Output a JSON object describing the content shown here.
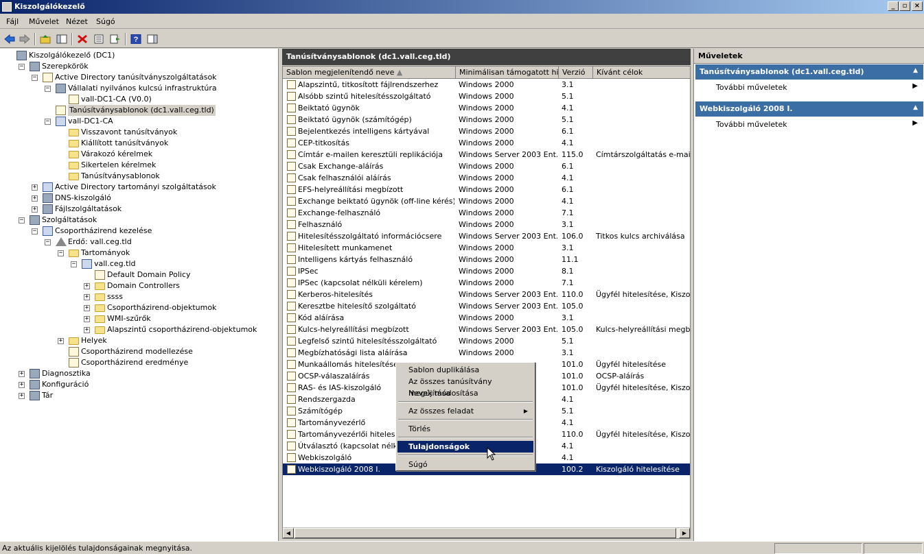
{
  "window": {
    "title": "Kiszolgálókezelő"
  },
  "menu": [
    "Fájl",
    "Művelet",
    "Nézet",
    "Súgó"
  ],
  "toolbar": {
    "buttons": [
      "back-icon",
      "forward-icon",
      "up-folder-icon",
      "show-hide-tree-icon",
      "delete-icon",
      "properties-icon",
      "export-icon",
      "help-icon",
      "show-hide-action-pane-icon"
    ]
  },
  "tree": [
    {
      "label": "Kiszolgálókezelő (DC1)",
      "depth": 0,
      "toggle": "",
      "icon": "server"
    },
    {
      "label": "Szerepkörök",
      "depth": 1,
      "toggle": "-",
      "icon": "server"
    },
    {
      "label": "Active Directory tanúsítványszolgáltatások",
      "depth": 2,
      "toggle": "-",
      "icon": "cert"
    },
    {
      "label": "Vállalati nyilvános kulcsú infrastruktúra",
      "depth": 3,
      "toggle": "-",
      "icon": "server"
    },
    {
      "label": "vall-DC1-CA (V0.0)",
      "depth": 4,
      "toggle": "",
      "icon": "cert"
    },
    {
      "label": "Tanúsítványsablonok (dc1.vall.ceg.tld)",
      "depth": 3,
      "toggle": "",
      "icon": "cert",
      "selected": true
    },
    {
      "label": "vall-DC1-CA",
      "depth": 3,
      "toggle": "-",
      "icon": "ad"
    },
    {
      "label": "Visszavont tanúsítványok",
      "depth": 4,
      "toggle": "",
      "icon": "folder"
    },
    {
      "label": "Kiállított tanúsítványok",
      "depth": 4,
      "toggle": "",
      "icon": "folder"
    },
    {
      "label": "Várakozó kérelmek",
      "depth": 4,
      "toggle": "",
      "icon": "folder"
    },
    {
      "label": "Sikertelen kérelmek",
      "depth": 4,
      "toggle": "",
      "icon": "folder"
    },
    {
      "label": "Tanúsítványsablonok",
      "depth": 4,
      "toggle": "",
      "icon": "folder"
    },
    {
      "label": "Active Directory tartományi szolgáltatások",
      "depth": 2,
      "toggle": "+",
      "icon": "ad"
    },
    {
      "label": "DNS-kiszolgáló",
      "depth": 2,
      "toggle": "+",
      "icon": "server"
    },
    {
      "label": "Fájlszolgáltatások",
      "depth": 2,
      "toggle": "+",
      "icon": "server"
    },
    {
      "label": "Szolgáltatások",
      "depth": 1,
      "toggle": "-",
      "icon": "server"
    },
    {
      "label": "Csoportházirend kezelése",
      "depth": 2,
      "toggle": "-",
      "icon": "ad"
    },
    {
      "label": "Erdő: vall.ceg.tld",
      "depth": 3,
      "toggle": "-",
      "icon": "tri"
    },
    {
      "label": "Tartományok",
      "depth": 4,
      "toggle": "-",
      "icon": "folder"
    },
    {
      "label": "vall.ceg.tld",
      "depth": 5,
      "toggle": "-",
      "icon": "ad"
    },
    {
      "label": "Default Domain Policy",
      "depth": 6,
      "toggle": "",
      "icon": "cert"
    },
    {
      "label": "Domain Controllers",
      "depth": 6,
      "toggle": "+",
      "icon": "folder"
    },
    {
      "label": "ssss",
      "depth": 6,
      "toggle": "+",
      "icon": "folder"
    },
    {
      "label": "Csoportházirend-objektumok",
      "depth": 6,
      "toggle": "+",
      "icon": "folder"
    },
    {
      "label": "WMI-szűrők",
      "depth": 6,
      "toggle": "+",
      "icon": "folder"
    },
    {
      "label": "Alapszintű csoportházirend-objektumok",
      "depth": 6,
      "toggle": "+",
      "icon": "folder"
    },
    {
      "label": "Helyek",
      "depth": 4,
      "toggle": "+",
      "icon": "folder"
    },
    {
      "label": "Csoportházirend modellezése",
      "depth": 4,
      "toggle": "",
      "icon": "cert"
    },
    {
      "label": "Csoportházirend eredménye",
      "depth": 4,
      "toggle": "",
      "icon": "cert"
    },
    {
      "label": "Diagnosztika",
      "depth": 1,
      "toggle": "+",
      "icon": "server"
    },
    {
      "label": "Konfiguráció",
      "depth": 1,
      "toggle": "+",
      "icon": "server"
    },
    {
      "label": "Tár",
      "depth": 1,
      "toggle": "+",
      "icon": "server"
    }
  ],
  "main": {
    "title": "Tanúsítványsablonok (dc1.vall.ceg.tld)",
    "columns": [
      "Sablon megjelenítendő neve",
      "Minimálisan támogatott hit...",
      "Verzió",
      "Kívánt célok"
    ],
    "rows": [
      [
        "Alapszintű, titkosított fájlrendszerhez",
        "Windows 2000",
        "3.1",
        ""
      ],
      [
        "Alsóbb szintű hitelesítésszolgáltató",
        "Windows 2000",
        "5.1",
        ""
      ],
      [
        "Beiktató ügynök",
        "Windows 2000",
        "4.1",
        ""
      ],
      [
        "Beiktató ügynök (számítógép)",
        "Windows 2000",
        "5.1",
        ""
      ],
      [
        "Bejelentkezés intelligens kártyával",
        "Windows 2000",
        "6.1",
        ""
      ],
      [
        "CEP-titkosítás",
        "Windows 2000",
        "4.1",
        ""
      ],
      [
        "Címtár e-mailen keresztüli replikációja",
        "Windows Server 2003 Ent...",
        "115.0",
        "Címtárszolgáltatás e-mailes r"
      ],
      [
        "Csak Exchange-aláírás",
        "Windows 2000",
        "6.1",
        ""
      ],
      [
        "Csak felhasználói aláírás",
        "Windows 2000",
        "4.1",
        ""
      ],
      [
        "EFS-helyreállítási megbízott",
        "Windows 2000",
        "6.1",
        ""
      ],
      [
        "Exchange beiktató ügynök (off-line kérés)",
        "Windows 2000",
        "4.1",
        ""
      ],
      [
        "Exchange-felhasználó",
        "Windows 2000",
        "7.1",
        ""
      ],
      [
        "Felhasználó",
        "Windows 2000",
        "3.1",
        ""
      ],
      [
        "Hitelesítésszolgáltató információcsere",
        "Windows Server 2003 Ent...",
        "106.0",
        "Titkos kulcs archiválása"
      ],
      [
        "Hitelesített munkamenet",
        "Windows 2000",
        "3.1",
        ""
      ],
      [
        "Intelligens kártyás felhasználó",
        "Windows 2000",
        "11.1",
        ""
      ],
      [
        "IPSec",
        "Windows 2000",
        "8.1",
        ""
      ],
      [
        "IPSec (kapcsolat nélküli kérelem)",
        "Windows 2000",
        "7.1",
        ""
      ],
      [
        "Kerberos-hitelesítés",
        "Windows Server 2003 Ent...",
        "110.0",
        "Ügyfél hitelesítése, Kiszolgál"
      ],
      [
        "Keresztbe hitelesítő szolgáltató",
        "Windows Server 2003 Ent...",
        "105.0",
        ""
      ],
      [
        "Kód aláírása",
        "Windows 2000",
        "3.1",
        ""
      ],
      [
        "Kulcs-helyreállítási megbízott",
        "Windows Server 2003 Ent...",
        "105.0",
        "Kulcs-helyreállítási megbízott"
      ],
      [
        "Legfelső szintű hitelesítésszolgáltató",
        "Windows 2000",
        "5.1",
        ""
      ],
      [
        "Megbízhatósági lista aláírása",
        "Windows 2000",
        "3.1",
        ""
      ],
      [
        "Munkaállomás hitelesítése",
        "...",
        "101.0",
        "Ügyfél hitelesítése"
      ],
      [
        "OCSP-válaszaláírás",
        "...ent...",
        "101.0",
        "OCSP-aláírás"
      ],
      [
        "RAS- és IAS-kiszolgáló",
        "...ent...",
        "101.0",
        "Ügyfél hitelesítése, Kiszolgál"
      ],
      [
        "Rendszergazda",
        "",
        "4.1",
        ""
      ],
      [
        "Számítógép",
        "",
        "5.1",
        ""
      ],
      [
        "Tartományvezérlő",
        "",
        "4.1",
        ""
      ],
      [
        "Tartományvezérlői hitelesítés",
        "...ent...",
        "110.0",
        "Ügyfél hitelesítése, Kiszolgál"
      ],
      [
        "Útválasztó (kapcsolat nélküli kérelem)",
        "",
        "4.1",
        ""
      ],
      [
        "Webkiszolgáló",
        "",
        "4.1",
        ""
      ],
      [
        "Webkiszolgáló 2008 I.",
        "...ent...",
        "100.2",
        "Kiszolgáló hitelesítése"
      ]
    ],
    "selected_row": 33
  },
  "context_menu": {
    "items": [
      {
        "label": "Sablon duplikálása"
      },
      {
        "label": "Az összes tanúsítvány megújítása"
      },
      {
        "label": "Nevek módosítása"
      },
      {
        "sep": true
      },
      {
        "label": "Az összes feladat",
        "submenu": true
      },
      {
        "sep": true
      },
      {
        "label": "Törlés"
      },
      {
        "sep": true
      },
      {
        "label": "Tulajdonságok",
        "highlighted": true
      },
      {
        "sep": true
      },
      {
        "label": "Súgó"
      }
    ]
  },
  "actions": {
    "header": "Műveletek",
    "sections": [
      {
        "title": "Tanúsítványsablonok (dc1.vall.ceg.tld)",
        "item": "További műveletek"
      },
      {
        "title": "Webkiszolgáló 2008 I.",
        "item": "További műveletek"
      }
    ]
  },
  "status": {
    "text": "Az aktuális kijelölés tulajdonságainak megnyitása."
  },
  "colors": {
    "accent": "#0a246a",
    "section": "#3a6ea5",
    "chrome": "#d4d0c8"
  }
}
